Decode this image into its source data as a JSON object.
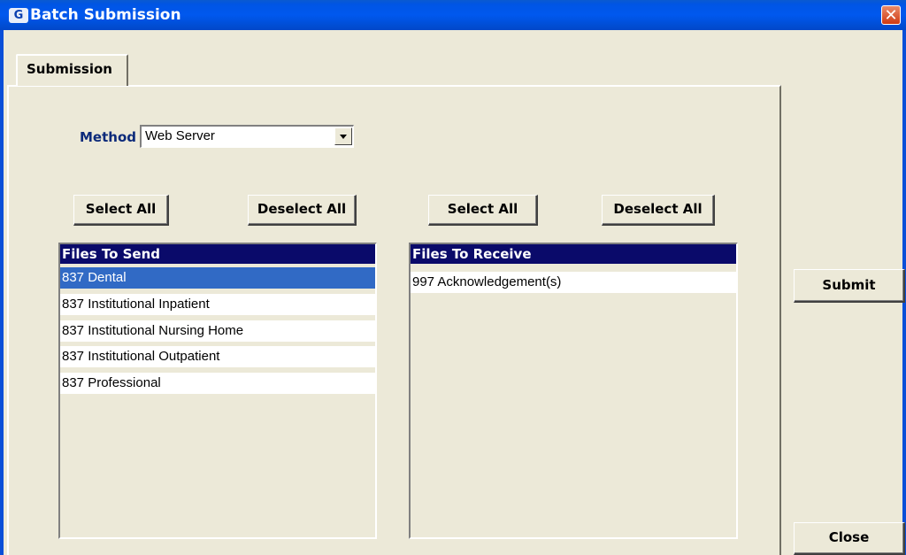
{
  "window": {
    "title": "Batch Submission",
    "icon": "app-logo-icon",
    "close_glyph": "✕"
  },
  "tabs": [
    {
      "label": "Submission",
      "active": true
    }
  ],
  "method": {
    "label": "Method",
    "value": "Web Server"
  },
  "send_panel": {
    "select_all": "Select All",
    "deselect_all": "Deselect All",
    "header": "Files To Send",
    "items": [
      {
        "label": "837 Dental",
        "selected": true
      },
      {
        "label": "837 Institutional Inpatient",
        "selected": false
      },
      {
        "label": "837 Institutional Nursing Home",
        "selected": false
      },
      {
        "label": "837 Institutional Outpatient",
        "selected": false
      },
      {
        "label": "837 Professional",
        "selected": false
      }
    ]
  },
  "receive_panel": {
    "select_all": "Select All",
    "deselect_all": "Deselect All",
    "header": "Files To Receive",
    "items": [
      {
        "label": "997 Acknowledgement(s)",
        "selected": false
      }
    ]
  },
  "actions": {
    "submit": "Submit",
    "close": "Close"
  },
  "colors": {
    "titlebar": "#0058ee",
    "list_header": "#0a0a6a",
    "selection": "#316ac5",
    "face": "#ece9d8"
  }
}
